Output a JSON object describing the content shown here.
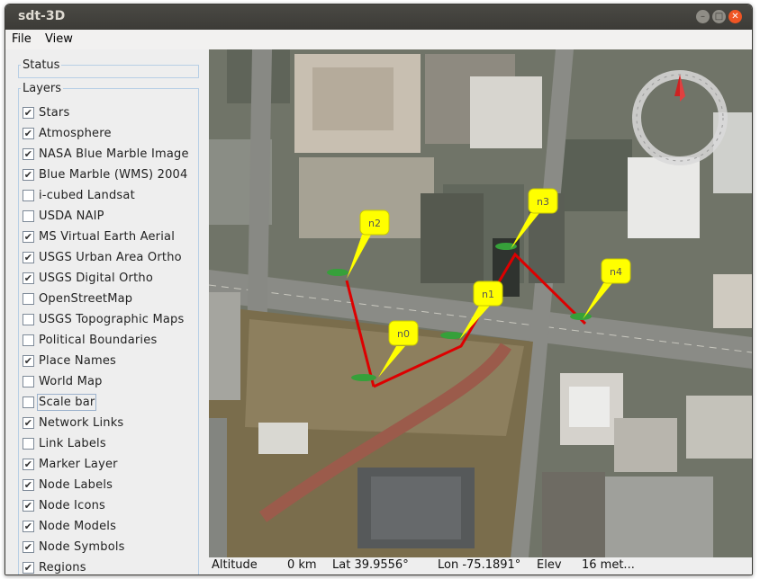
{
  "window": {
    "title": "sdt-3D"
  },
  "menu": {
    "file": "File",
    "view": "View"
  },
  "panel": {
    "status_label": "Status",
    "layers_label": "Layers"
  },
  "layers": [
    {
      "label": "Stars",
      "checked": true
    },
    {
      "label": "Atmosphere",
      "checked": true
    },
    {
      "label": "NASA Blue Marble Image",
      "checked": true
    },
    {
      "label": "Blue Marble (WMS) 2004",
      "checked": true
    },
    {
      "label": "i-cubed Landsat",
      "checked": false
    },
    {
      "label": "USDA NAIP",
      "checked": false
    },
    {
      "label": "MS Virtual Earth Aerial",
      "checked": true
    },
    {
      "label": "USGS Urban Area Ortho",
      "checked": true
    },
    {
      "label": "USGS Digital Ortho",
      "checked": true
    },
    {
      "label": "OpenStreetMap",
      "checked": false
    },
    {
      "label": "USGS Topographic Maps",
      "checked": false
    },
    {
      "label": "Political Boundaries",
      "checked": false
    },
    {
      "label": "Place Names",
      "checked": true
    },
    {
      "label": "World Map",
      "checked": false
    },
    {
      "label": "Scale bar",
      "checked": false
    },
    {
      "label": "Network Links",
      "checked": true
    },
    {
      "label": "Link Labels",
      "checked": false
    },
    {
      "label": "Marker Layer",
      "checked": true
    },
    {
      "label": "Node Labels",
      "checked": true
    },
    {
      "label": "Node Icons",
      "checked": true
    },
    {
      "label": "Node Models",
      "checked": true
    },
    {
      "label": "Node Symbols",
      "checked": true
    },
    {
      "label": "Regions",
      "checked": true
    }
  ],
  "nodes": [
    "n0",
    "n1",
    "n2",
    "n3",
    "n4"
  ],
  "status": {
    "altitude_label": "Altitude",
    "altitude_value": "0 km",
    "lat": "Lat 39.9556°",
    "lon": "Lon -75.1891°",
    "elev_label": "Elev",
    "elev_value": "16 met..."
  },
  "colors": {
    "link": "#dd0000",
    "node_label": "#ffff00",
    "titlebar": "#3c3b37"
  }
}
